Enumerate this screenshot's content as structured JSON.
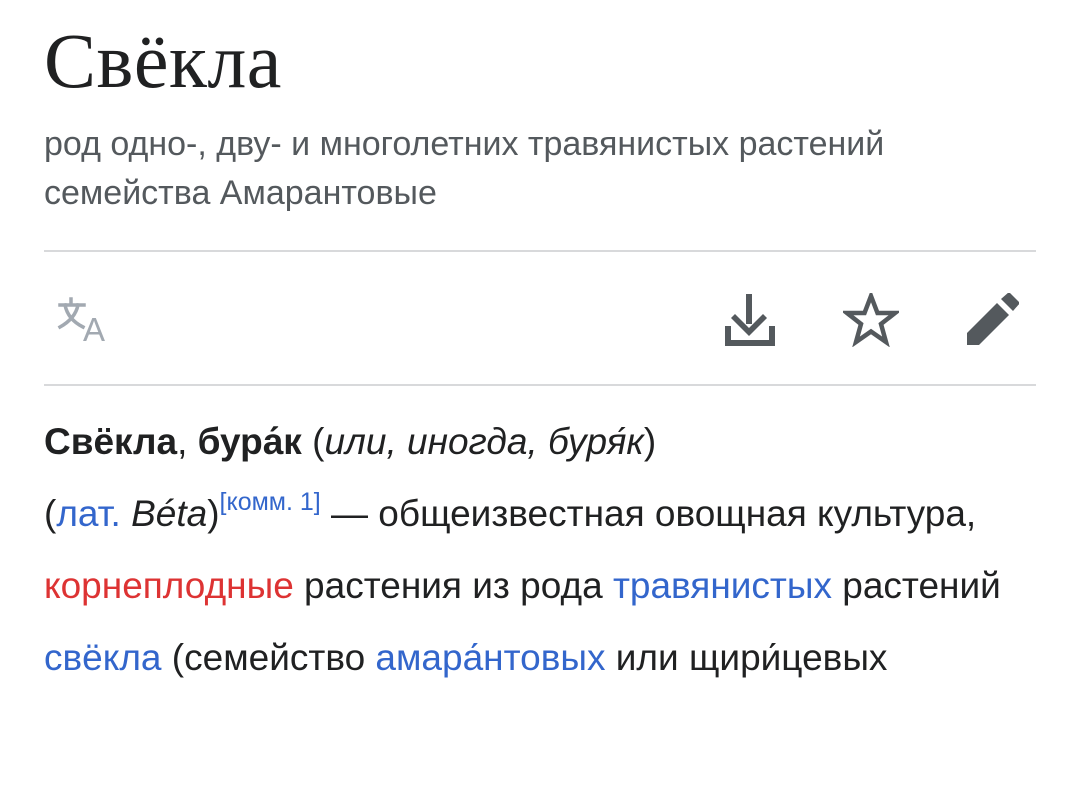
{
  "article": {
    "title": "Свёкла",
    "description": "род одно-, дву- и многолетних травянистых растений семейства Амарантовые",
    "toolbar": {
      "language_icon": "translate-icon",
      "download_icon": "download-icon",
      "bookmark_icon": "star-icon",
      "edit_icon": "pencil-icon"
    },
    "lead": {
      "name1": "Свёкла",
      "comma1": ", ",
      "name2": "бура́к",
      "alt_prefix": " (",
      "alt_text": "или, иногда, буря́к",
      "alt_suffix": ")",
      "latin_open": "(",
      "latin_link": "лат.",
      "latin_space": " ",
      "latin_name": "Béta",
      "latin_close": ")",
      "note1": "[комм. 1]",
      "text1": " — общеизвестная овощная культура, ",
      "link_red": "корнеплодные",
      "text2": " растения из рода ",
      "link1": "травянистых",
      "text3": " растений ",
      "link2": "свёкла",
      "text4": " (семейство ",
      "link3": "амара́нтовых",
      "text5": " или щири́цевых"
    },
    "colors": {
      "link": "#3366cc",
      "redlink": "#d33",
      "text": "#202122",
      "muted": "#54595d",
      "icon_disabled": "#a2a9b1",
      "icon_active": "#54595d"
    }
  }
}
